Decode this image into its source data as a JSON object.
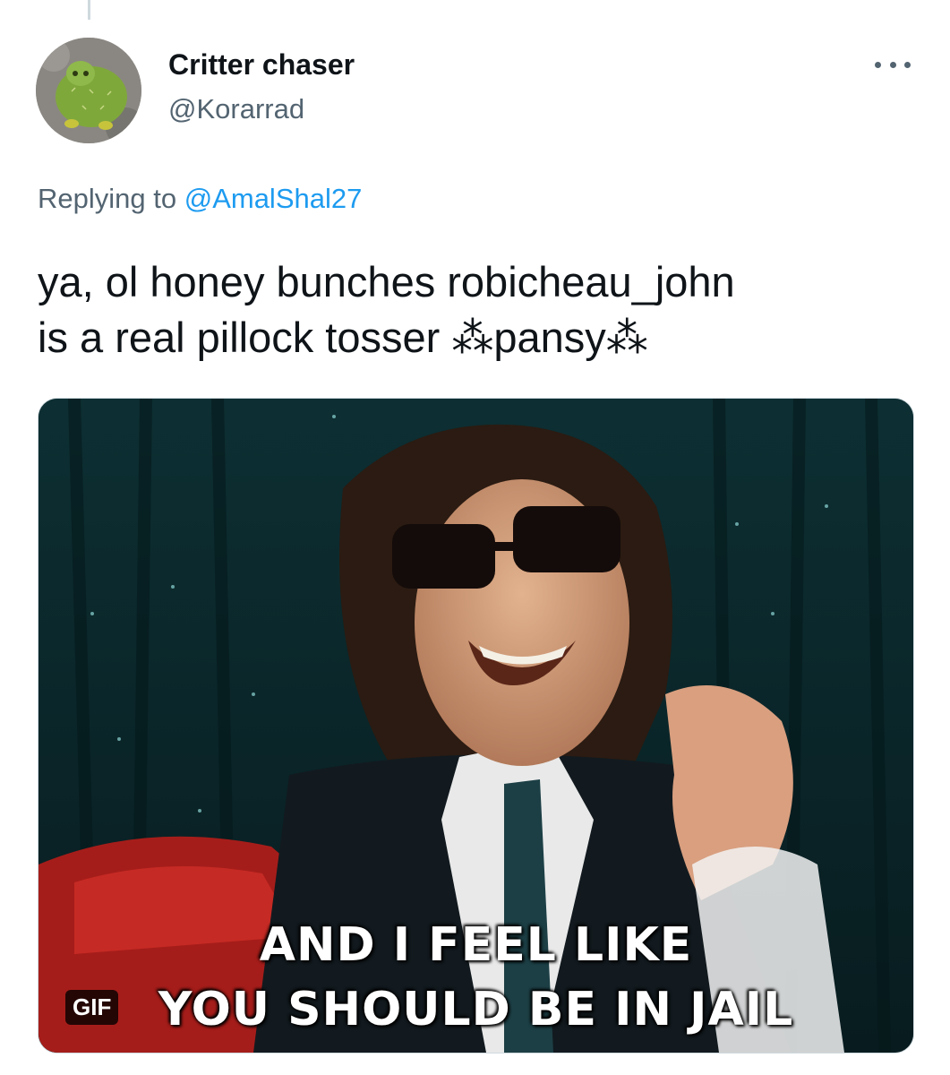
{
  "tweet": {
    "display_name": "Critter chaser",
    "handle": "@Korarrad",
    "replying_prefix": "Replying to",
    "replying_to": "@AmalShal27",
    "text_line1": "ya, ol honey bunches   robicheau_john",
    "text_line2": "is a real pillock tosser  ⁂pansy⁂",
    "media": {
      "badge": "GIF",
      "caption_line1": "AND I FEEL LIKE",
      "caption_line2": "YOU SHOULD BE IN JAIL"
    }
  },
  "colors": {
    "link": "#1d9bf0",
    "secondary_text": "#536471",
    "primary_text": "#0f1419"
  },
  "icons": {
    "more": "more-horizontal-icon"
  }
}
